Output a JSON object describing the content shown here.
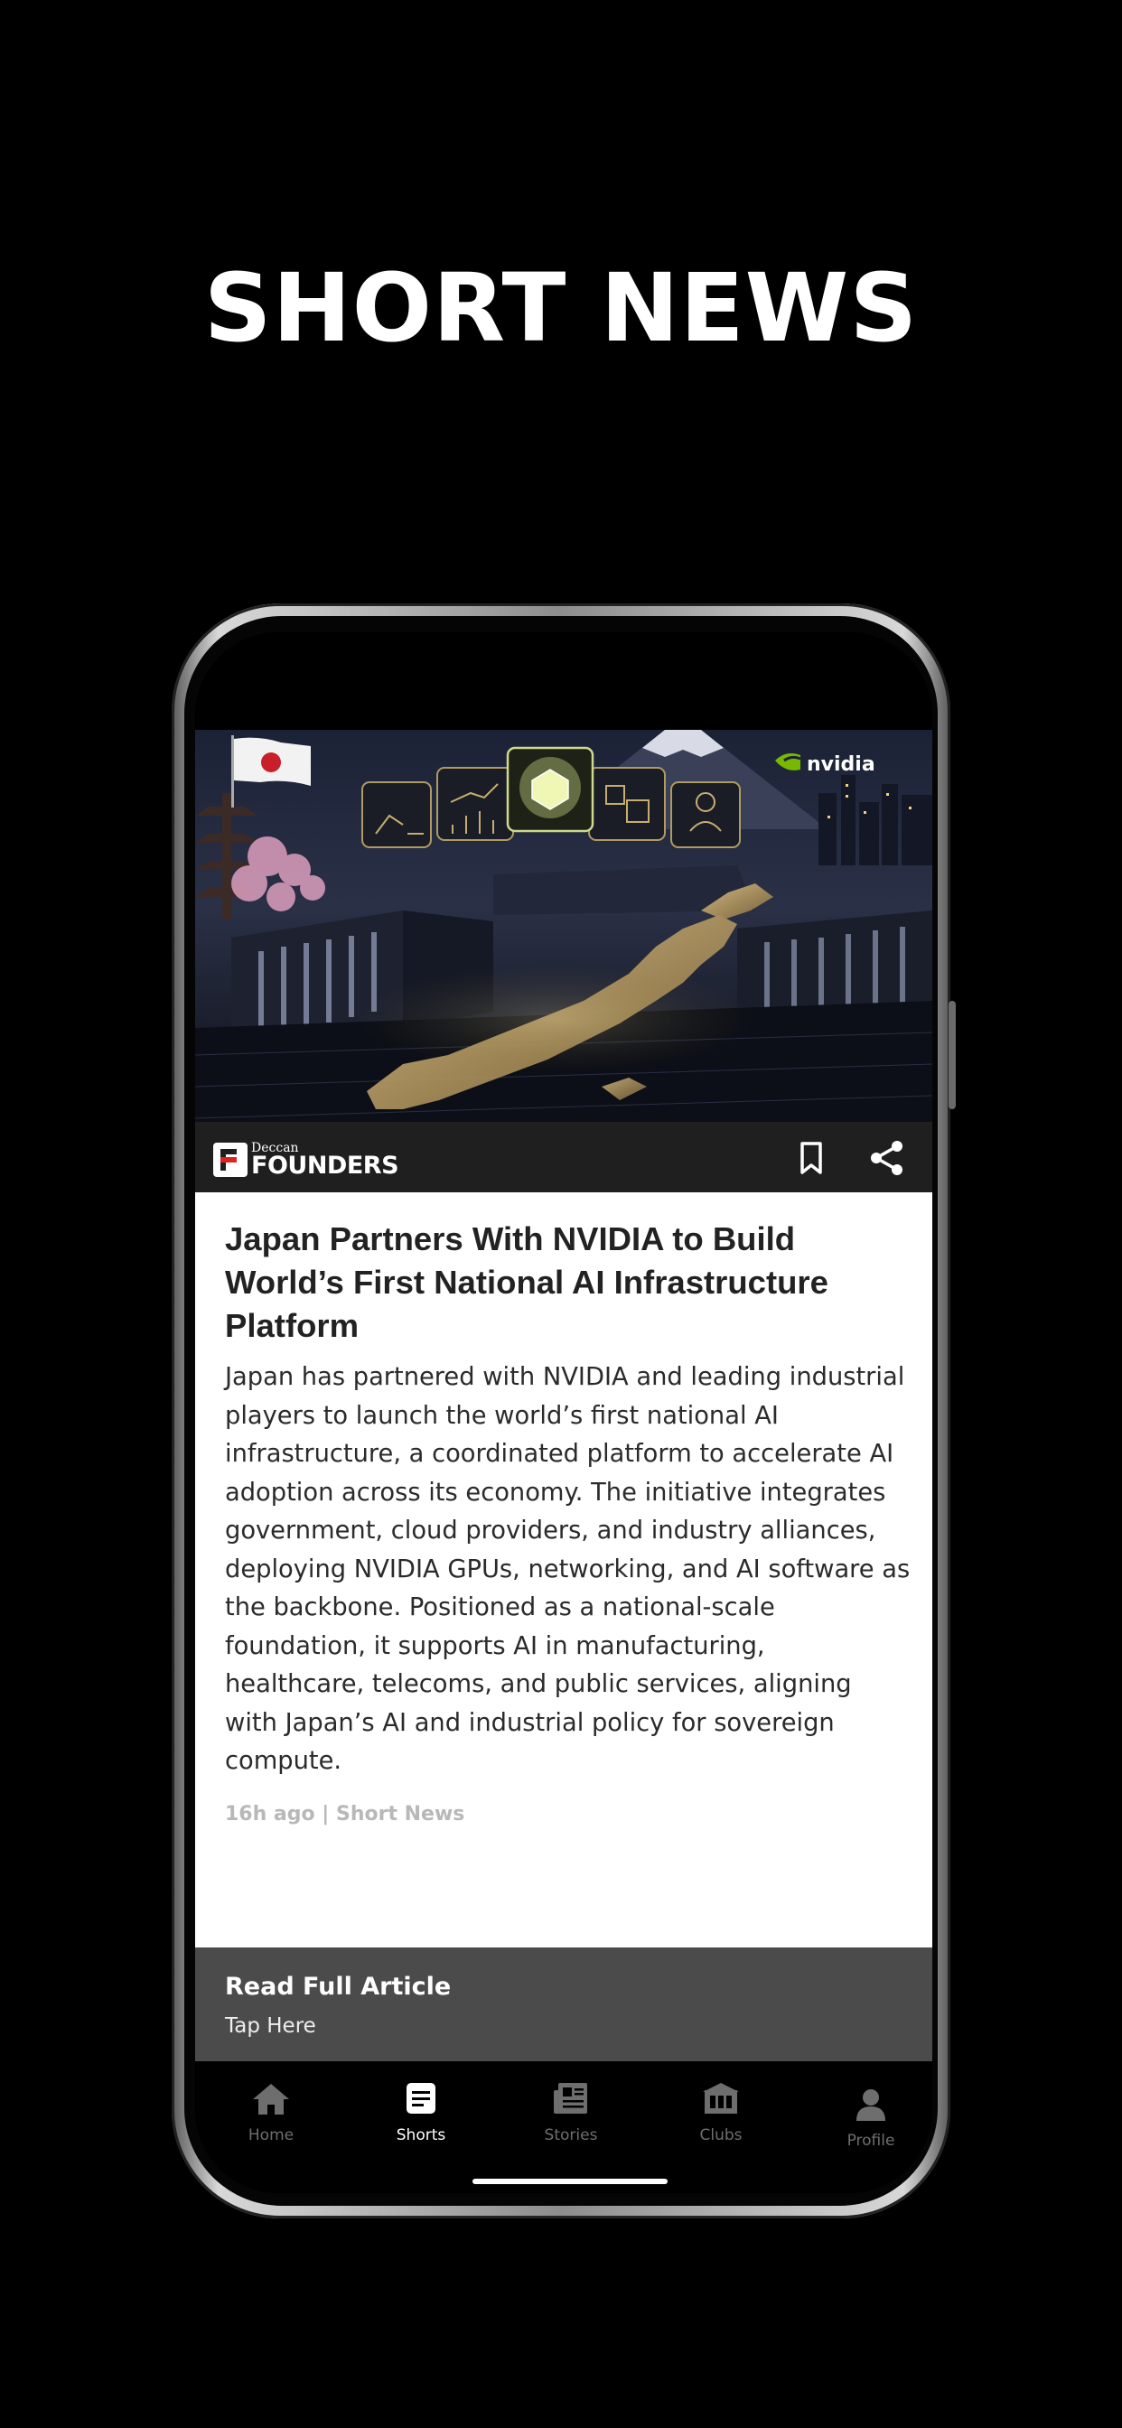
{
  "headline": "SHORT NEWS",
  "article": {
    "hero_overlay_brand": "nvidia",
    "source_logo": {
      "small": "Deccan",
      "big": "FOUNDERS"
    },
    "title": "Japan Partners With NVIDIA to Build World’s First National AI Infrastructure Platform",
    "body": "Japan has partnered with NVIDIA and leading industrial players to launch the world’s first national AI infrastructure, a coordinated platform to accelerate AI adoption across its economy. The initiative integrates government, cloud providers, and industry alliances, deploying NVIDIA GPUs, networking, and AI software as the backbone. Positioned as a national-scale foundation, it supports AI in manufacturing, healthcare, telecoms, and public services, aligning with Japan’s AI and industrial policy for sovereign compute.",
    "meta": "16h ago | Short News"
  },
  "read_more": {
    "title": "Read Full Article",
    "subtitle": "Tap Here"
  },
  "tabs": [
    {
      "label": "Home",
      "icon": "home-icon",
      "active": false
    },
    {
      "label": "Shorts",
      "icon": "shorts-icon",
      "active": true
    },
    {
      "label": "Stories",
      "icon": "stories-icon",
      "active": false
    },
    {
      "label": "Clubs",
      "icon": "clubs-icon",
      "active": false
    },
    {
      "label": "Profile",
      "icon": "profile-icon",
      "active": false
    }
  ],
  "colors": {
    "background": "#000000",
    "accent_green": "#76b900",
    "brand_bar": "#1f1f1f",
    "read_more_bg": "#4b4b4b"
  }
}
